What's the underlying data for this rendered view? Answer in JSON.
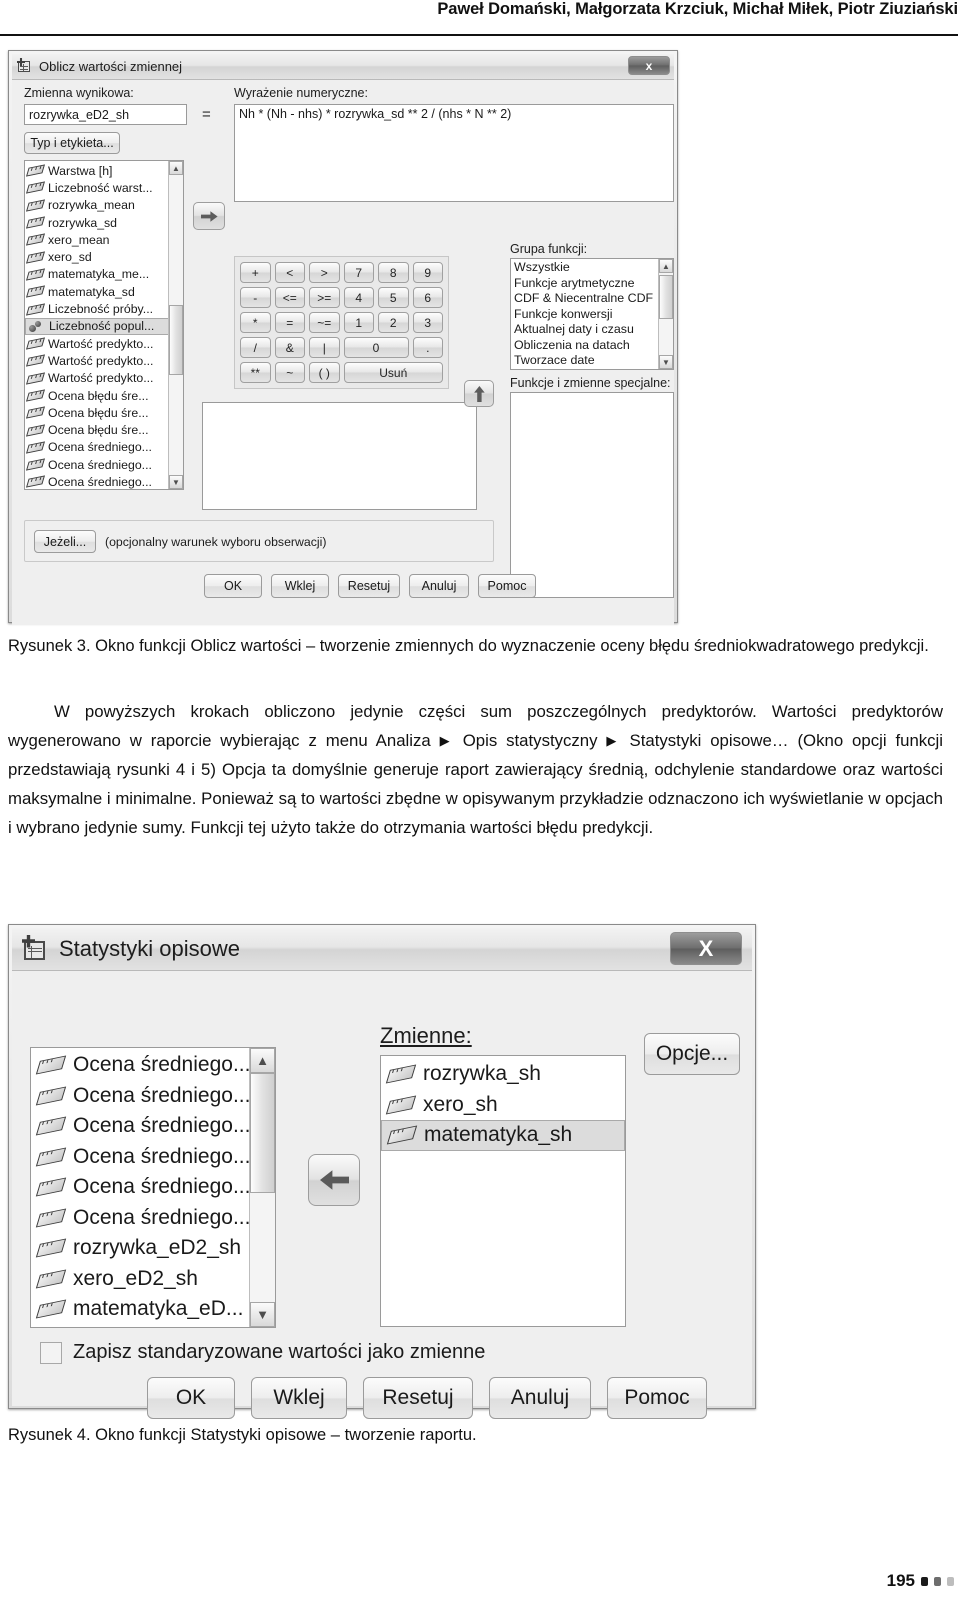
{
  "running_head": "Paweł Domański, Małgorzata Krzciuk, Michał Miłek, Piotr Ziuziański",
  "page_number": "195",
  "figure3": {
    "title": "Oblicz wartości zmiennej",
    "close_label": "x",
    "target_label": "Zmienna wynikowa:",
    "target_value": "rozrywka_eD2_sh",
    "type_label_button": "Typ i etykieta...",
    "equals": "=",
    "expression_label": "Wyrażenie numeryczne:",
    "expression_value": "Nh * (Nh - nhs) * rozrywka_sd ** 2 / (nhs * N ** 2)",
    "variables": [
      {
        "name": "Warstwa [h]",
        "icon": "ruler-icon",
        "selected": false
      },
      {
        "name": "Liczebność warst...",
        "icon": "ruler-icon",
        "selected": false
      },
      {
        "name": "rozrywka_mean",
        "icon": "ruler-icon",
        "selected": false
      },
      {
        "name": "rozrywka_sd",
        "icon": "ruler-icon",
        "selected": false
      },
      {
        "name": "xero_mean",
        "icon": "ruler-icon",
        "selected": false
      },
      {
        "name": "xero_sd",
        "icon": "ruler-icon",
        "selected": false
      },
      {
        "name": "matematyka_me...",
        "icon": "ruler-icon",
        "selected": false
      },
      {
        "name": "matematyka_sd",
        "icon": "ruler-icon",
        "selected": false
      },
      {
        "name": "Liczebność próby...",
        "icon": "ruler-icon",
        "selected": false
      },
      {
        "name": "Liczebność popul...",
        "icon": "nominal-icon",
        "selected": true
      },
      {
        "name": "Wartość predykto...",
        "icon": "ruler-icon",
        "selected": false
      },
      {
        "name": "Wartość predykto...",
        "icon": "ruler-icon",
        "selected": false
      },
      {
        "name": "Wartość predykto...",
        "icon": "ruler-icon",
        "selected": false
      },
      {
        "name": "Ocena błędu śre...",
        "icon": "ruler-icon",
        "selected": false
      },
      {
        "name": "Ocena błędu śre...",
        "icon": "ruler-icon",
        "selected": false
      },
      {
        "name": "Ocena błędu śre...",
        "icon": "ruler-icon",
        "selected": false
      },
      {
        "name": "Ocena średniego...",
        "icon": "ruler-icon",
        "selected": false
      },
      {
        "name": "Ocena średniego...",
        "icon": "ruler-icon",
        "selected": false
      },
      {
        "name": "Ocena średniego...",
        "icon": "ruler-icon",
        "selected": false
      }
    ],
    "keypad": [
      "+",
      "<",
      ">",
      "7",
      "8",
      "9",
      "-",
      "<=",
      ">=",
      "4",
      "5",
      "6",
      "*",
      "=",
      "~=",
      "1",
      "2",
      "3",
      "/",
      "&",
      "|",
      "0",
      ".",
      "**",
      "~",
      "( )",
      "Usuń"
    ],
    "keypad_rows": [
      [
        "+",
        "<",
        ">",
        "7",
        "8",
        "9"
      ],
      [
        "-",
        "<=",
        ">=",
        "4",
        "5",
        "6"
      ],
      [
        "*",
        "=",
        "~=",
        "1",
        "2",
        "3"
      ],
      [
        "/",
        "&",
        "|",
        "0",
        "."
      ],
      [
        "**",
        "~",
        "( )",
        "Usuń"
      ]
    ],
    "function_group_label": "Grupa funkcji:",
    "function_groups": [
      "Wszystkie",
      "Funkcje arytmetyczne",
      "CDF & Niecentralne CDF",
      "Funkcje konwersji",
      "Aktualnej daty i czasu",
      "Obliczenia na datach",
      "Tworzace date"
    ],
    "special_functions_label": "Funkcje i zmienne specjalne:",
    "if_button": "Jeżeli...",
    "if_hint": "(opcjonalny warunek wyboru obserwacji)",
    "buttons": [
      "OK",
      "Wklej",
      "Resetuj",
      "Anuluj",
      "Pomoc"
    ]
  },
  "caption3": "Rysunek 3. Okno funkcji Oblicz wartości – tworzenie zmiennych do wyznaczenie oceny błędu średniokwadratowego predykcji.",
  "paragraph": {
    "l1": "W powyższych krokach obliczono jedynie części sum poszczególnych predyktorów.",
    "l2a": "Wartości predyktorów wygenerowano w raporcie wybierając z menu Analiza ",
    "l2b": " Opis statystyczny",
    "l3a": " Statystyki opisowe… (Okno opcji funkcji przedstawiają rysunki 4 i 5) Opcja ta domyślnie",
    "l4": "generuje raport zawierający średnią, odchylenie standardowe oraz wartości maksymalne",
    "l5": "i minimalne. Ponieważ są to wartości zbędne w opisywanym przykładzie odznaczono ich",
    "l6": "wyświetlanie w opcjach i wybrano jedynie sumy. Funkcji tej użyto także do otrzymania wartości",
    "l7": "błędu predykcji."
  },
  "figure4": {
    "title": "Statystyki opisowe",
    "close_label": "X",
    "source_variables": [
      {
        "name": "Ocena średniego...",
        "selected": false
      },
      {
        "name": "Ocena średniego...",
        "selected": false
      },
      {
        "name": "Ocena średniego...",
        "selected": false
      },
      {
        "name": "Ocena średniego...",
        "selected": false
      },
      {
        "name": "Ocena średniego...",
        "selected": false
      },
      {
        "name": "Ocena średniego...",
        "selected": false
      },
      {
        "name": "rozrywka_eD2_sh",
        "selected": false
      },
      {
        "name": "xero_eD2_sh",
        "selected": false
      },
      {
        "name": "matematyka_eD...",
        "selected": false
      }
    ],
    "variables_label": "Zmienne:",
    "selected_variables": [
      {
        "name": "rozrywka_sh",
        "selected": false
      },
      {
        "name": "xero_sh",
        "selected": false
      },
      {
        "name": "matematyka_sh",
        "selected": true
      }
    ],
    "options_button": "Opcje...",
    "checkbox_label": "Zapisz standaryzowane wartości jako zmienne",
    "checkbox_checked": false,
    "buttons": [
      "OK",
      "Wklej",
      "Resetuj",
      "Anuluj",
      "Pomoc"
    ]
  },
  "caption4": "Rysunek 4. Okno funkcji Statystyki opisowe – tworzenie raportu."
}
